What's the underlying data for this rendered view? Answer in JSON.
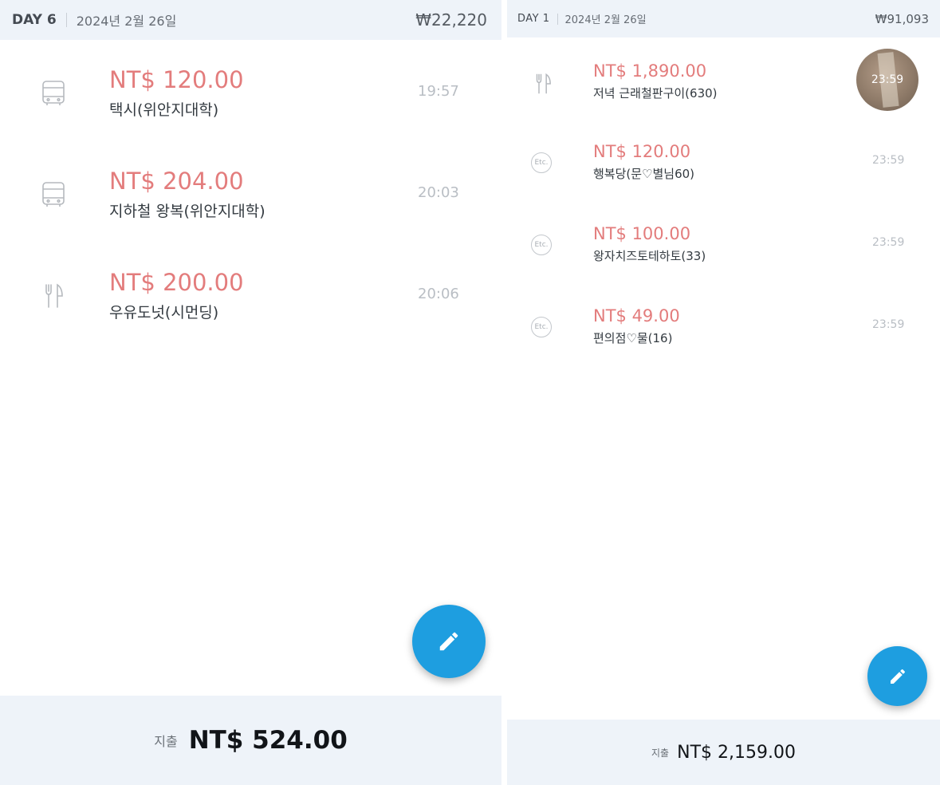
{
  "left_panel": {
    "header": {
      "day": "DAY 6",
      "date": "2024년 2월 26일",
      "krw_total": "₩22,220"
    },
    "items": [
      {
        "icon": "bus-icon",
        "amount": "NT$ 120.00",
        "label": "택시(위안지대학)",
        "time": "19:57"
      },
      {
        "icon": "bus-icon",
        "amount": "NT$ 204.00",
        "label": "지하철 왕복(위안지대학)",
        "time": "20:03"
      },
      {
        "icon": "fork-knife-icon",
        "amount": "NT$ 200.00",
        "label": "우유도넛(시먼딩)",
        "time": "20:06"
      }
    ],
    "fab": {
      "icon": "pencil-icon"
    },
    "footer": {
      "label": "지출",
      "total": "NT$ 524.00"
    }
  },
  "right_panel": {
    "header": {
      "day": "DAY 1",
      "date": "2024년 2월 26일",
      "krw_total": "₩91,093"
    },
    "items": [
      {
        "icon": "fork-knife-icon",
        "amount": "NT$ 1,890.00",
        "label": "저녁 근래철판구이(630)",
        "time": "23:59",
        "has_photo": true
      },
      {
        "icon": "etc-icon",
        "icon_text": "Etc.",
        "amount": "NT$ 120.00",
        "label": "행복당(문♡별님60)",
        "time": "23:59"
      },
      {
        "icon": "etc-icon",
        "icon_text": "Etc.",
        "amount": "NT$ 100.00",
        "label": "왕자치즈토테하토(33)",
        "time": "23:59"
      },
      {
        "icon": "etc-icon",
        "icon_text": "Etc.",
        "amount": "NT$ 49.00",
        "label": "편의점♡물(16)",
        "time": "23:59"
      }
    ],
    "fab": {
      "icon": "pencil-icon"
    },
    "footer": {
      "label": "지출",
      "total": "NT$ 2,159.00"
    }
  },
  "colors": {
    "amount": "#e37c7c",
    "header_bg": "#eef3f9",
    "fab": "#1e9ee0",
    "time": "#b9bec4"
  }
}
